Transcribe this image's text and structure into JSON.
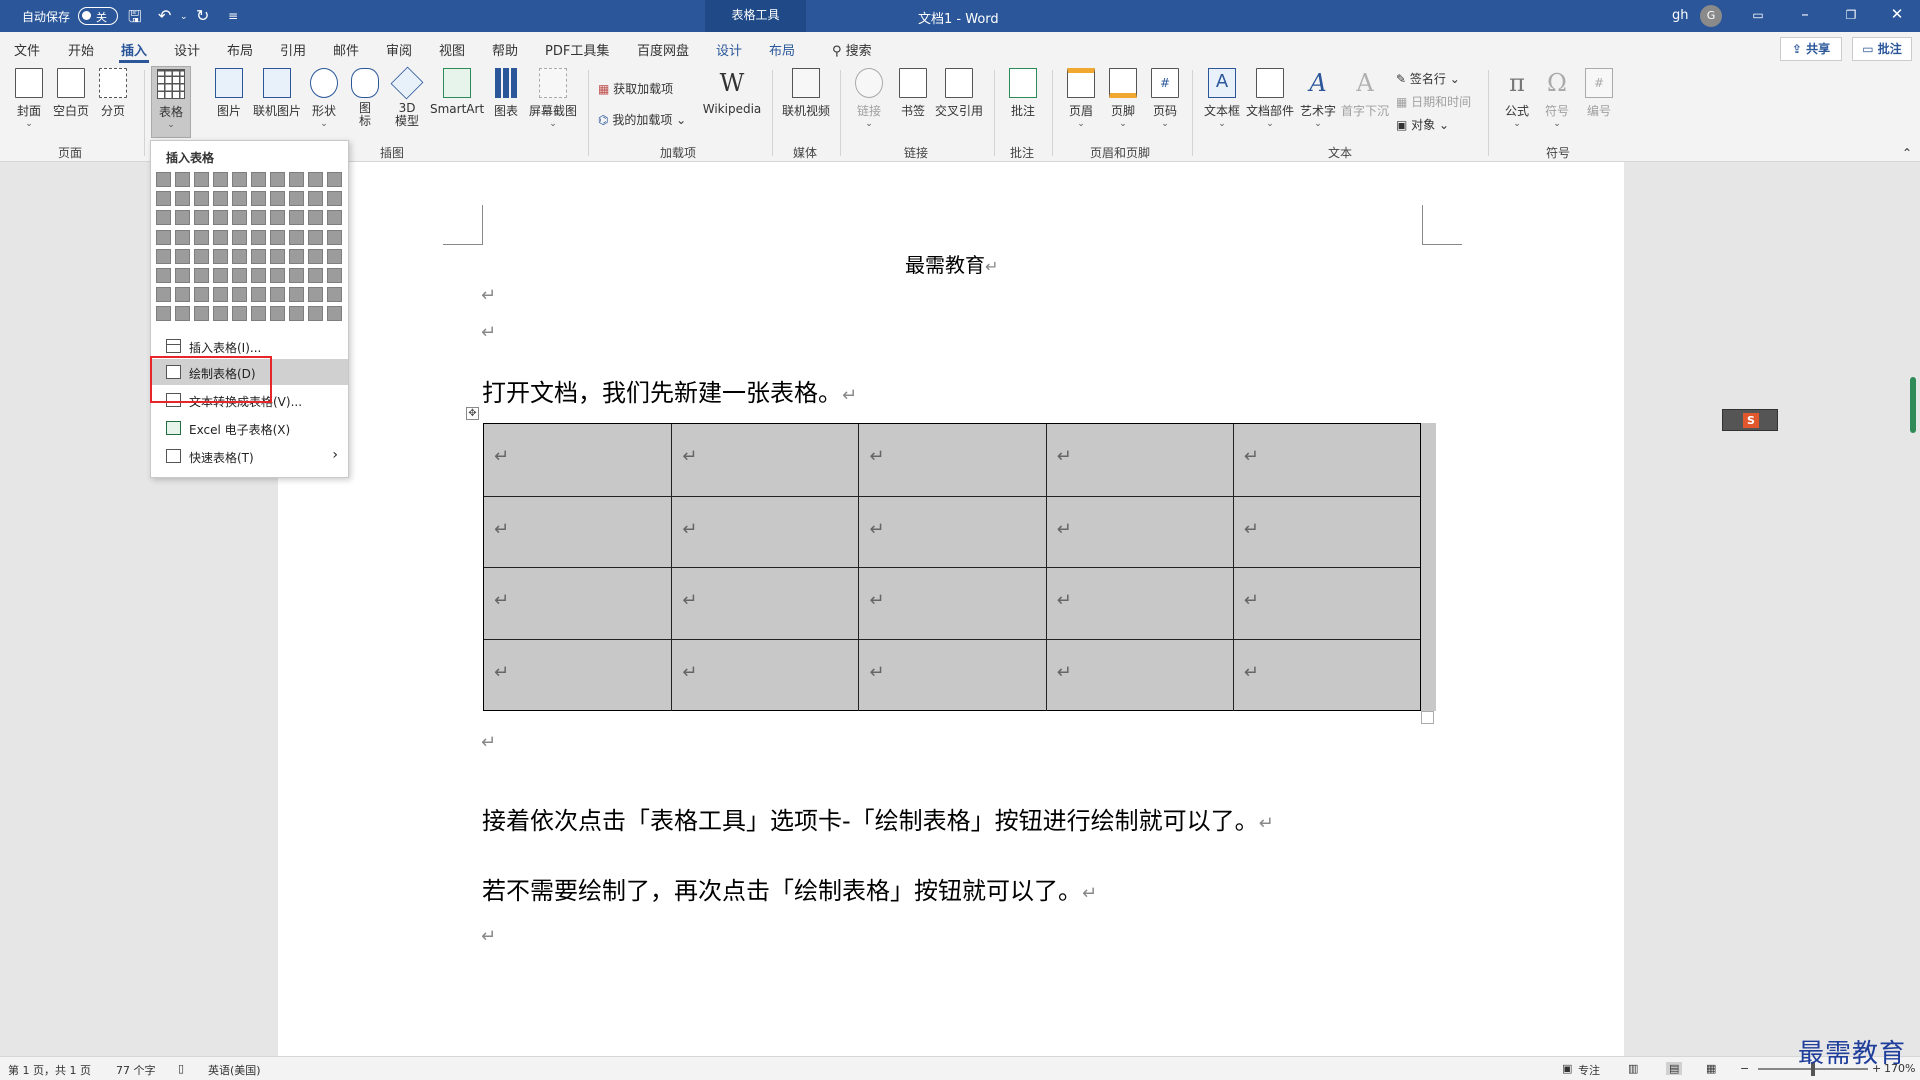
{
  "titlebar": {
    "autosave_label": "自动保存",
    "autosave_state": "关",
    "context_tab": "表格工具",
    "doc_title": "文档1  -  Word",
    "user": "gh",
    "avatar_initial": "G"
  },
  "tabs": [
    "文件",
    "开始",
    "插入",
    "设计",
    "布局",
    "引用",
    "邮件",
    "审阅",
    "视图",
    "帮助",
    "PDF工具集",
    "百度网盘",
    "设计",
    "布局"
  ],
  "active_tab": "插入",
  "search_label": "搜索",
  "share_label": "共享",
  "comments_label": "批注",
  "ribbon": {
    "pages_group": {
      "label": "页面",
      "items": [
        "封面",
        "空白页",
        "分页"
      ]
    },
    "table_btn": "表格",
    "illustrations_group": {
      "label": "插图",
      "items": [
        "图片",
        "联机图片",
        "形状",
        "图标",
        "3D模型",
        "SmartArt",
        "图表",
        "屏幕截图"
      ]
    },
    "icon_label_lines": [
      "图",
      "标"
    ],
    "model_label_lines": [
      "3D",
      "模型"
    ],
    "addins_group": {
      "label": "加载项",
      "get_addins": "获取加载项",
      "my_addins": "我的加载项",
      "wikipedia": "Wikipedia"
    },
    "media_group": {
      "label": "媒体",
      "item": "联机视频"
    },
    "links_group": {
      "label": "链接",
      "items": [
        "链接",
        "书签",
        "交叉引用"
      ]
    },
    "comments_group": {
      "label": "批注",
      "item": "批注"
    },
    "header_footer_group": {
      "label": "页眉和页脚",
      "items": [
        "页眉",
        "页脚",
        "页码"
      ]
    },
    "text_group": {
      "label": "文本",
      "items": [
        "文本框",
        "文档部件",
        "艺术字",
        "首字下沉"
      ],
      "signature": "签名行",
      "datetime": "日期和时间",
      "object": "对象"
    },
    "symbols_group": {
      "label": "符号",
      "items": [
        "公式",
        "符号",
        "编号"
      ]
    }
  },
  "dropdown": {
    "title": "插入表格",
    "items": [
      {
        "label": "插入表格(I)...",
        "icon": "table-grid-icon"
      },
      {
        "label": "绘制表格(D)",
        "icon": "pencil-table-icon"
      },
      {
        "label": "文本转换成表格(V)...",
        "icon": "text-to-table-icon"
      },
      {
        "label": "Excel 电子表格(X)",
        "icon": "excel-icon"
      },
      {
        "label": "快速表格(T)",
        "icon": "quick-table-icon"
      }
    ],
    "highlighted_item": "绘制表格(D)"
  },
  "document": {
    "header": "最需教育",
    "para1": "打开文档，我们先新建一张表格。",
    "para2": "接着依次点击「表格工具」选项卡-「绘制表格」按钮进行绘制就可以了。",
    "para3": "若不需要绘制了，再次点击「绘制表格」按钮就可以了。",
    "paragraph_mark": "↵",
    "table": {
      "rows": 4,
      "cols": 5
    }
  },
  "statusbar": {
    "page": "第 1 页，共 1 页",
    "words": "77 个字",
    "language": "英语(美国)",
    "focus": "专注",
    "zoom": "170%",
    "zoom_minus": "−",
    "zoom_plus": "+"
  },
  "watermark": "最需教育",
  "colors": {
    "accent": "#2b579a",
    "highlight_box": "#e8262a",
    "table_fill": "#c8c8c8"
  }
}
